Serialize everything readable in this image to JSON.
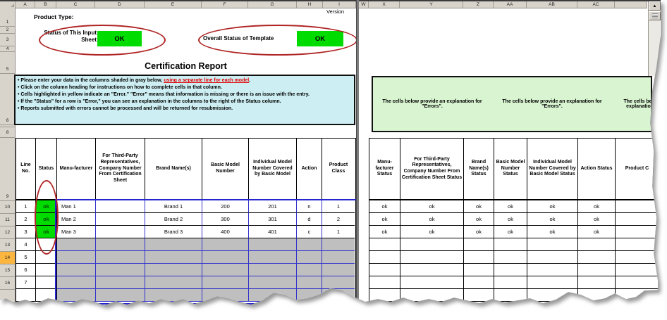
{
  "sheet": {
    "left_column_letters": [
      "A",
      "B",
      "C",
      "D",
      "E",
      "F",
      "G",
      "H",
      "I"
    ],
    "right_column_letters": [
      "W",
      "X",
      "Y",
      "Z",
      "AA",
      "AB",
      "AC",
      ""
    ],
    "row_numbers": [
      "1",
      "2",
      "3",
      "4",
      "5",
      "6",
      "",
      "8",
      "9",
      "10",
      "11",
      "12",
      "13",
      "14",
      "15",
      "16",
      ""
    ],
    "highlighted_row_number": "14"
  },
  "header": {
    "product_type_label": "Product Type:",
    "version_label": "Version",
    "input_sheet_status_label": "Status of This Input Sheet",
    "input_sheet_status_value": "OK",
    "overall_status_label": "Overall Status of Template",
    "overall_status_value": "OK",
    "title": "Certification Report"
  },
  "instructions": {
    "items": [
      {
        "text": "• Please enter your data in the columns shaded in gray below,  ",
        "link": "using a separate line for each model",
        "suffix": "."
      },
      {
        "text": "• Click on the column heading for instructions on how to complete cells in that column."
      },
      {
        "text": "• Cells highlighted in yellow indicate an \"Error.\"  \"Error\" means that information is missing or there is an issue with the entry."
      },
      {
        "text": "• If the \"Status\" for a row is \"Error,\" you can see an explanation in the columns to the right of the Status column."
      },
      {
        "text": "• Reports submitted with errors cannot be processed and will be returned for resubmission."
      }
    ]
  },
  "explanation_note": "The cells below provide an explanation for \"Errors\".",
  "left_table": {
    "headers": [
      "Line No.",
      "Status",
      "Manu-facturer",
      "For Third-Party Representatives, Company Number From Certification Sheet",
      "Brand Name(s)",
      "Basic Model Number",
      "Individual Model Number Covered by Basic Model",
      "Action",
      "Product Class"
    ],
    "rows": [
      [
        "1",
        "ok",
        "Man 1",
        "",
        "Brand 1",
        "200",
        "201",
        "n",
        "1"
      ],
      [
        "2",
        "ok",
        "Man 2",
        "",
        "Brand 2",
        "300",
        "301",
        "d",
        "2"
      ],
      [
        "3",
        "ok",
        "Man 3",
        "",
        "Brand 3",
        "400",
        "401",
        "c",
        "1"
      ],
      [
        "4",
        "",
        "",
        "",
        "",
        "",
        "",
        "",
        ""
      ],
      [
        "5",
        "",
        "",
        "",
        "",
        "",
        "",
        "",
        ""
      ],
      [
        "6",
        "",
        "",
        "",
        "",
        "",
        "",
        "",
        ""
      ],
      [
        "7",
        "",
        "",
        "",
        "",
        "",
        "",
        "",
        ""
      ],
      [
        "",
        "",
        "",
        "",
        "",
        "",
        "",
        "",
        ""
      ]
    ]
  },
  "right_table": {
    "headers": [
      "Manu-facturer Status",
      "For Third-Party Representatives, Company Number From Certification Sheet Status",
      "Brand Name(s) Status",
      "Basic Model Number Status",
      "Individual Model Number Covered by Basic Model Status",
      "Action Status",
      "Product C"
    ],
    "rows": [
      [
        "ok",
        "ok",
        "ok",
        "ok",
        "ok",
        "ok",
        ""
      ],
      [
        "ok",
        "ok",
        "ok",
        "ok",
        "ok",
        "ok",
        ""
      ],
      [
        "ok",
        "ok",
        "ok",
        "ok",
        "ok",
        "ok",
        ""
      ],
      [
        "",
        "",
        "",
        "",
        "",
        "",
        ""
      ],
      [
        "",
        "",
        "",
        "",
        "",
        "",
        ""
      ],
      [
        "",
        "",
        "",
        "",
        "",
        "",
        ""
      ],
      [
        "",
        "",
        "",
        "",
        "",
        "",
        ""
      ],
      [
        "",
        "",
        "",
        "",
        "",
        "",
        ""
      ]
    ]
  },
  "scrollbar": {
    "up_arrow": "▲"
  },
  "colors": {
    "status_ok_green": "#00dc00",
    "instructions_cyan": "#cdeef2",
    "explanation_green": "#d8f4d0",
    "input_gray": "#bfbfbf",
    "grid_blue": "#3333cc",
    "annotation_red": "#b02525",
    "highlight_orange": "#fcb53f",
    "header_chrome": "#d8d4cc"
  }
}
